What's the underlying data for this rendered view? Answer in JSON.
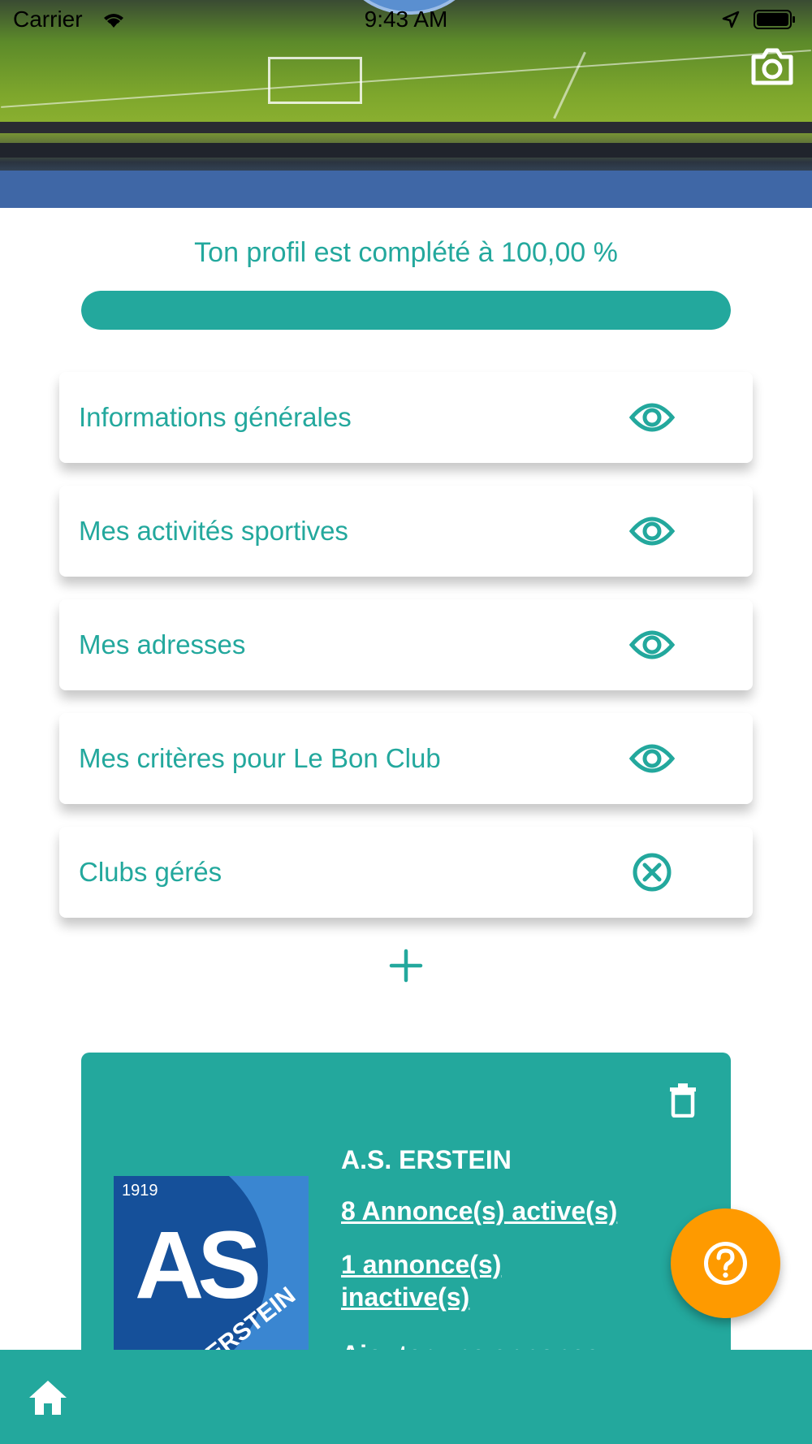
{
  "status_bar": {
    "carrier": "Carrier",
    "time": "9:43 AM"
  },
  "header": {
    "camera_icon": "camera-icon"
  },
  "profile": {
    "completion_text": "Ton profil est complété à 100,00 %",
    "completion_value": 1.0
  },
  "sections": [
    {
      "label": "Informations générales",
      "icon": "eye-icon"
    },
    {
      "label": "Mes activités sportives",
      "icon": "eye-icon"
    },
    {
      "label": "Mes adresses",
      "icon": "eye-icon"
    },
    {
      "label": "Mes critères pour Le Bon Club",
      "icon": "eye-icon"
    },
    {
      "label": "Clubs gérés",
      "icon": "close-circle-icon"
    }
  ],
  "club": {
    "name": "A.S. ERSTEIN",
    "active_ads": "8 Annonce(s) active(s)",
    "inactive_ads": "1 annonce(s) inactive(s)",
    "add_ad": "Ajouter une annonce",
    "logo": {
      "year": "1919",
      "letters": "AS",
      "city": "ERSTEIN"
    }
  },
  "colors": {
    "accent": "#23a89d",
    "help": "#fe9a00"
  }
}
